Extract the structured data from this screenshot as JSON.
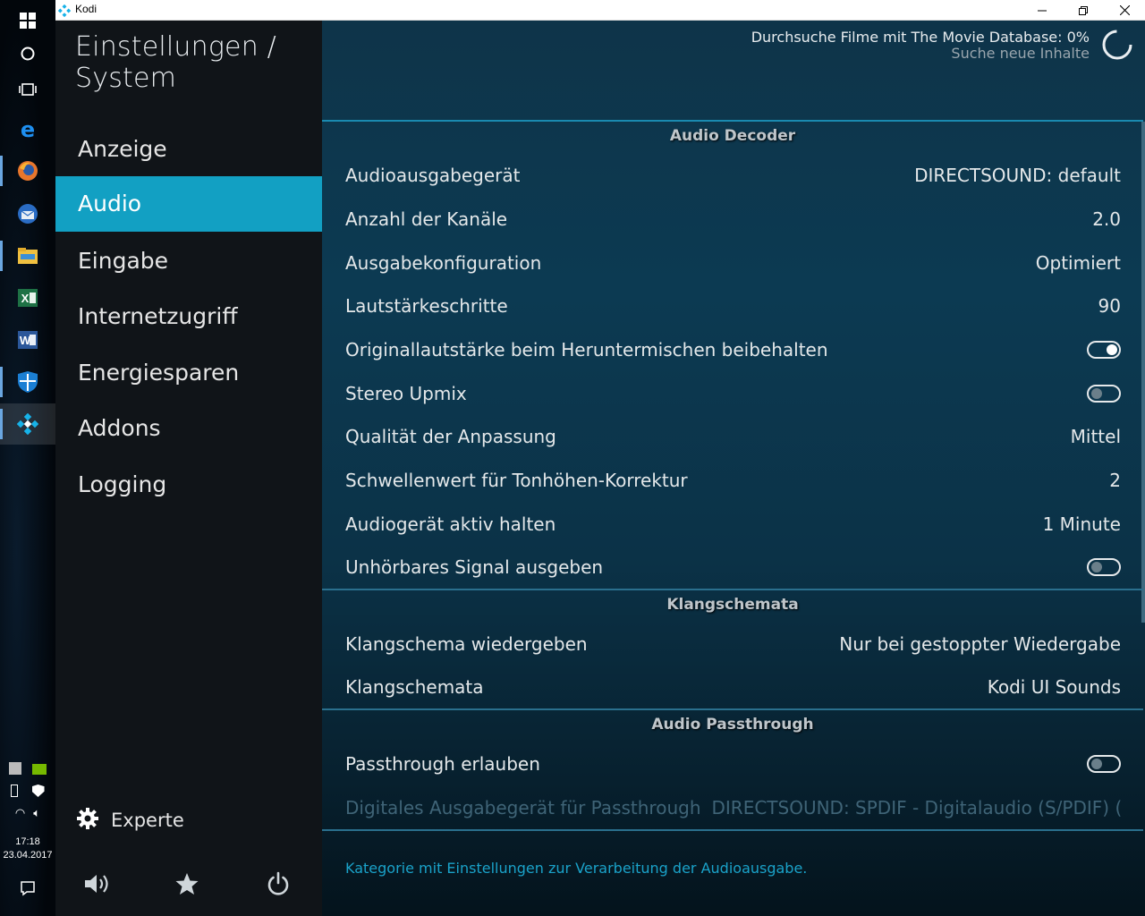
{
  "window": {
    "title": "Kodi"
  },
  "taskbar": {
    "time": "17:18",
    "date": "23.04.2017"
  },
  "header": {
    "title": "Einstellungen / System"
  },
  "notification": {
    "title": "Durchsuche Filme mit The Movie Database:  0%",
    "subtitle": "Suche neue Inhalte"
  },
  "sidebar": {
    "items": [
      {
        "label": "Anzeige",
        "selected": false
      },
      {
        "label": "Audio",
        "selected": true
      },
      {
        "label": "Eingabe",
        "selected": false
      },
      {
        "label": "Internetzugriff",
        "selected": false
      },
      {
        "label": "Energiesparen",
        "selected": false
      },
      {
        "label": "Addons",
        "selected": false
      },
      {
        "label": "Logging",
        "selected": false
      }
    ],
    "level_label": "Experte"
  },
  "sections": {
    "decoder": {
      "title": "Audio Decoder",
      "rows": [
        {
          "label": "Audioausgabegerät",
          "value": "DIRECTSOUND: default"
        },
        {
          "label": "Anzahl der Kanäle",
          "value": "2.0"
        },
        {
          "label": "Ausgabekonfiguration",
          "value": "Optimiert"
        },
        {
          "label": "Lautstärkeschritte",
          "value": "90"
        },
        {
          "label": "Originallautstärke beim Heruntermischen beibehalten",
          "toggle": true
        },
        {
          "label": "Stereo Upmix",
          "toggle": false
        },
        {
          "label": "Qualität der Anpassung",
          "value": "Mittel"
        },
        {
          "label": "Schwellenwert für Tonhöhen-Korrektur",
          "value": "2"
        },
        {
          "label": "Audiogerät aktiv halten",
          "value": "1 Minute"
        },
        {
          "label": "Unhörbares Signal ausgeben",
          "toggle": false
        }
      ]
    },
    "klang": {
      "title": "Klangschemata",
      "rows": [
        {
          "label": "Klangschema wiedergeben",
          "value": "Nur bei gestoppter Wiedergabe"
        },
        {
          "label": "Klangschemata",
          "value": "Kodi UI Sounds"
        }
      ]
    },
    "passthrough": {
      "title": "Audio Passthrough",
      "rows": [
        {
          "label": "Passthrough erlauben",
          "toggle": false
        },
        {
          "label": "Digitales Ausgabegerät für Passthrough",
          "value": "DIRECTSOUND: SPDIF - Digitalaudio (S/PDIF) (High D...",
          "disabled": true
        }
      ]
    }
  },
  "description": "Kategorie mit Einstellungen zur Verarbeitung der Audioausgabe.",
  "colors": {
    "accent": "#12a0c3",
    "sidebar_bg": "#101418",
    "panel_bg": "#0c3a52"
  }
}
